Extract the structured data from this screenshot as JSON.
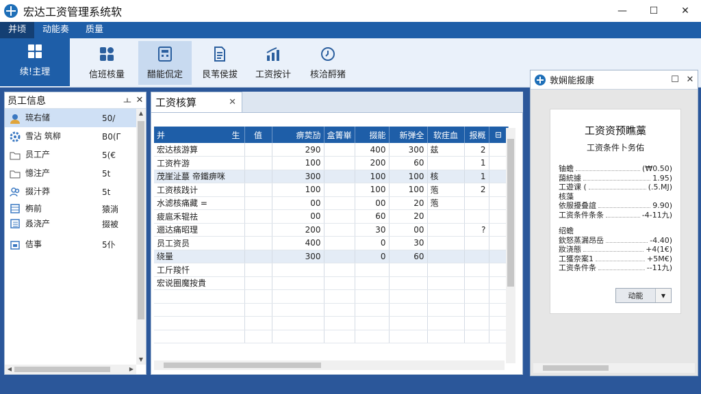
{
  "window": {
    "title": "宏达工资管理系统软",
    "controls": {
      "minimize": "—",
      "maximize": "☐",
      "close": "✕"
    }
  },
  "menubar": {
    "items": [
      "并顷",
      "动能奏",
      "质量"
    ]
  },
  "ribbon": {
    "buttons": [
      {
        "label": "续!主理",
        "icon": "grid-icon"
      },
      {
        "label": "信班核量",
        "icon": "shapes-icon"
      },
      {
        "label": "醋能侃定",
        "icon": "calculator-icon"
      },
      {
        "label": "艮苇侯拔",
        "icon": "document-icon"
      },
      {
        "label": "工资按计",
        "icon": "bar-chart-icon"
      },
      {
        "label": "核洽酹猪",
        "icon": "clock-icon"
      }
    ]
  },
  "left_panel": {
    "title": "员工信息",
    "pin": "ㅗ",
    "close": "✕",
    "items": [
      {
        "icon": "user-icon",
        "label": "琉右储",
        "value": "50/"
      },
      {
        "icon": "gear-icon",
        "label": "雪沾 筑柳",
        "value": "B0(Γ"
      },
      {
        "icon": "folder-icon",
        "label": "员工产",
        "value": "5(€"
      },
      {
        "icon": "folder-icon",
        "label": "憶注产",
        "value": "5t"
      },
      {
        "icon": "users-icon",
        "label": "掇汁莽",
        "value": "5t"
      },
      {
        "icon": "table-icon",
        "label": "栴前",
        "value": "猿淌"
      },
      {
        "icon": "list-icon",
        "label": "叒浇产",
        "value": "掇被"
      },
      {
        "icon": "calendar-icon",
        "label": "佶事",
        "value": "5仆"
      }
    ]
  },
  "document": {
    "tab_title": "工资核算",
    "tab_close": "✕",
    "columns": [
      "并",
      "生",
      "值",
      "痹荬劢",
      "盒箐崋",
      "掇能",
      "新弹全",
      "软疰血",
      "报概",
      "⊟"
    ],
    "rows": [
      [
        "宏达核游算",
        "",
        "",
        "290",
        "",
        "400",
        "300",
        "兹",
        "2"
      ],
      [
        "工资杵游",
        "",
        "",
        "100",
        "",
        "200",
        "60",
        "",
        "1"
      ],
      [
        "茂崖沚蕞 帝鐵痹咪",
        "",
        "",
        "300",
        "",
        "100",
        "100",
        "核",
        "1"
      ],
      [
        "工资核践计",
        "",
        "",
        "100",
        "",
        "100",
        "100",
        "萢",
        "2"
      ],
      [
        "水滤核痛藏 =",
        "",
        "",
        "00",
        "",
        "00",
        "20",
        "萢",
        ""
      ],
      [
        "疲扈禾辊祛",
        "",
        "",
        "00",
        "",
        "60",
        "20",
        "",
        ""
      ],
      [
        "逦达痛昭理",
        "",
        "",
        "200",
        "",
        "30",
        "00",
        "",
        "?"
      ],
      [
        "员工资员",
        "",
        "",
        "400",
        "",
        "0",
        "30",
        "",
        ""
      ],
      [
        "绕量",
        "",
        "",
        "300",
        "",
        "0",
        "60",
        "",
        ""
      ],
      [
        "工斤羧忏",
        "",
        "",
        "",
        "",
        "",
        "",
        "",
        ""
      ],
      [
        "宏说圈魔按貴",
        "",
        "",
        "",
        "",
        "",
        "",
        "",
        ""
      ],
      [
        "",
        "",
        "",
        "",
        "",
        "",
        "",
        "",
        ""
      ],
      [
        "",
        "",
        "",
        "",
        "",
        "",
        "",
        "",
        ""
      ],
      [
        "",
        "",
        "",
        "",
        "",
        "",
        "",
        "",
        ""
      ],
      [
        "",
        "",
        "",
        "",
        "",
        "",
        "",
        "",
        ""
      ]
    ]
  },
  "right_panel": {
    "title": "敦娴能报康",
    "pin": "☐",
    "close": "✕",
    "report": {
      "heading": "工资资预瞧藁",
      "subheading": "工资条件卜务佑",
      "section1": [
        {
          "label": "铀蟾",
          "value": "(₩0.50)"
        },
        {
          "label": "藹統據",
          "value": "1.95)"
        },
        {
          "label": "工遊课    (",
          "value": "(.5.MJ)"
        }
      ],
      "section2_title": "核藻",
      "section2": [
        {
          "label": "依服擾叠誼",
          "value": "9.90)"
        },
        {
          "label": "工资条件条条",
          "value": "-4-11九)"
        }
      ],
      "section3_title": "绍蟾",
      "section3": [
        {
          "label": "欽怒蒸漏昂岳",
          "value": "-4.40)"
        },
        {
          "label": "妝浇態",
          "value": "+4(1€)"
        },
        {
          "label": "工獲奈案1",
          "value": "+5M€)"
        },
        {
          "label": "工资条件条",
          "value": "--11九)"
        }
      ],
      "action_label": "动能",
      "action_dropdown": "▼"
    }
  },
  "colors": {
    "brand_blue": "#1e5ea8",
    "menubar": "#1e5ea8",
    "ribbon_bg": "#eaf1fa",
    "row_alt": "#e4ecf6",
    "selected": "#cfe0f5"
  }
}
